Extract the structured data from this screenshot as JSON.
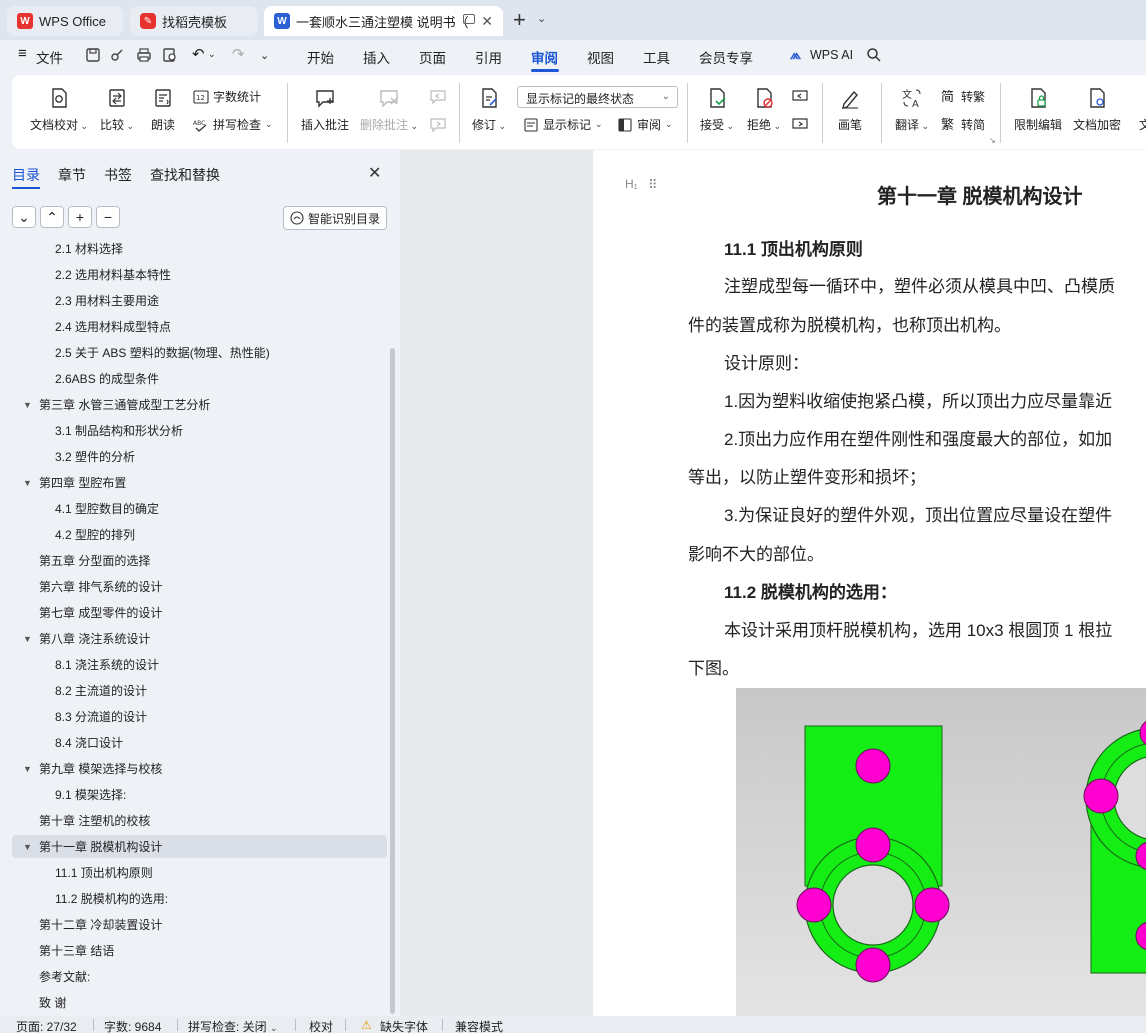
{
  "tabs": [
    {
      "label": "WPS Office"
    },
    {
      "label": "找稻壳模板"
    },
    {
      "label": "一套顺水三通注塑模 说明书（"
    }
  ],
  "menu": {
    "file": "文件",
    "items": [
      "开始",
      "插入",
      "页面",
      "引用",
      "审阅",
      "视图",
      "工具",
      "会员专享"
    ],
    "active": "审阅",
    "ai": "WPS AI"
  },
  "ribbon": {
    "doc_check": "文档校对",
    "compare": "比较",
    "read_aloud": "朗读",
    "word_count": "字数统计",
    "spell_check": "拼写检查",
    "insert_comment": "插入批注",
    "delete_comment": "删除批注",
    "revise": "修订",
    "display_select": "显示标记的最终状态",
    "show_markup": "显示标记",
    "review": "审阅",
    "accept": "接受",
    "reject": "拒绝",
    "pen": "画笔",
    "translate": "翻译",
    "to_traditional": "转繁",
    "to_simplified": "转简",
    "restrict_edit": "限制编辑",
    "encrypt": "文档加密",
    "more_cut": "文"
  },
  "nav": {
    "tabs": [
      "目录",
      "章节",
      "书签",
      "查找和替换"
    ],
    "smart_btn": "智能识别目录",
    "toc": [
      {
        "label": "2.1  材料选择",
        "level": 2
      },
      {
        "label": "2.2  选用材料基本特性",
        "level": 2
      },
      {
        "label": "2.3 用材料主要用途",
        "level": 2
      },
      {
        "label": "2.4  选用材料成型特点",
        "level": 2
      },
      {
        "label": "2.5  关于 ABS  塑料的数据(物理、热性能)",
        "level": 2
      },
      {
        "label": "2.6ABS  的成型条件",
        "level": 2
      },
      {
        "label": "第三章  水管三通管成型工艺分析",
        "level": 1,
        "expanded": true
      },
      {
        "label": "3.1 制品结构和形状分析",
        "level": 2
      },
      {
        "label": "3.2  塑件的分析",
        "level": 2
      },
      {
        "label": "第四章  型腔布置",
        "level": 1,
        "expanded": true
      },
      {
        "label": "4.1  型腔数目的确定",
        "level": 2
      },
      {
        "label": "4.2  型腔的排列",
        "level": 2
      },
      {
        "label": "第五章  分型面的选择",
        "level": 1
      },
      {
        "label": "第六章  排气系统的设计",
        "level": 1
      },
      {
        "label": "第七章  成型零件的设计",
        "level": 1
      },
      {
        "label": "第八章  浇注系统设计",
        "level": 1,
        "expanded": true
      },
      {
        "label": "8.1  浇注系统的设计",
        "level": 2
      },
      {
        "label": "8.2  主流道的设计",
        "level": 2
      },
      {
        "label": "8.3  分流道的设计",
        "level": 2
      },
      {
        "label": "8.4  浇口设计",
        "level": 2
      },
      {
        "label": "第九章  模架选择与校核",
        "level": 1,
        "expanded": true
      },
      {
        "label": "9.1  模架选择:",
        "level": 2
      },
      {
        "label": "第十章  注塑机的校核",
        "level": 1
      },
      {
        "label": "第十一章  脱模机构设计",
        "level": 1,
        "expanded": true,
        "selected": true
      },
      {
        "label": "11.1  顶出机构原则",
        "level": 2
      },
      {
        "label": "11.2  脱模机构的选用:",
        "level": 2
      },
      {
        "label": "第十二章  冷却装置设计",
        "level": 1
      },
      {
        "label": "第十三章  结语",
        "level": 1
      },
      {
        "label": "参考文献:",
        "level": 1
      },
      {
        "label": "致    谢",
        "level": 1
      }
    ]
  },
  "document": {
    "chapter_title": "第十一章  脱模机构设计",
    "s1_title": "11.1  顶出机构原则",
    "p1_l1": "注塑成型每一循环中，塑件必须从模具中凹、凸模质",
    "p1_l2": "件的装置成称为脱模机构，也称顶出机构。",
    "p2": "设计原则：",
    "p3": "1.因为塑料收缩使抱紧凸模，所以顶出力应尽量靠近",
    "p4_l1": "2.顶出力应作用在塑件刚性和强度最大的部位，如加",
    "p4_l2": "等出，以防止塑件变形和损坏；",
    "p5_l1": "3.为保证良好的塑件外观，顶出位置应尽量设在塑件",
    "p5_l2": "影响不大的部位。",
    "s2_title": "11.2  脱模机构的选用：",
    "p6_l1": "本设计采用顶杆脱模机构，选用 10x3 根圆顶 1 根拉",
    "p6_l2": "下图。",
    "heading_marker": "H₁"
  },
  "status": {
    "page": "页面: 27/32",
    "words": "字数: 9684",
    "spell": "拼写检查: 关闭",
    "proof": "校对",
    "missing_font": "缺失字体",
    "compat": "兼容模式"
  },
  "colors": {
    "accent": "#1a56d6",
    "figure_green": "#14ee14",
    "figure_magenta": "#ff00d0"
  }
}
